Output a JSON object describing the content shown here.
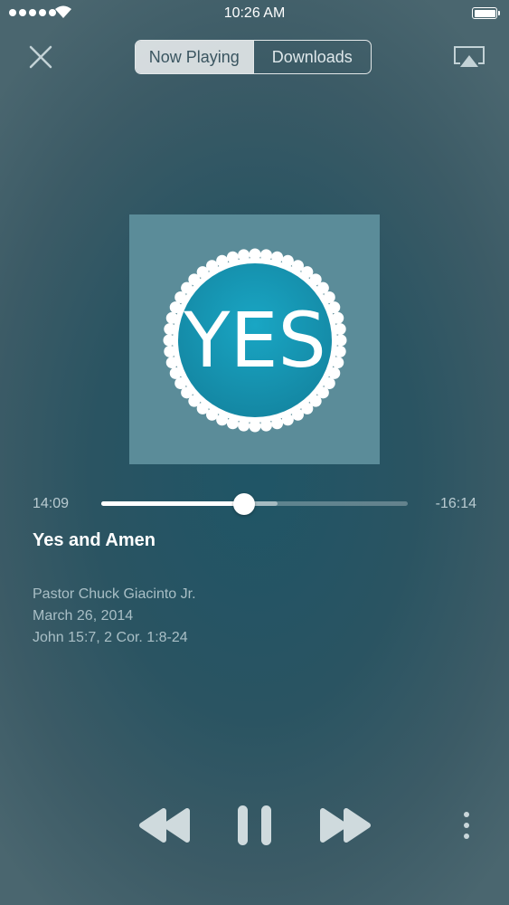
{
  "status_bar": {
    "time": "10:26 AM",
    "signal_bars": 5,
    "battery_level": 1.0
  },
  "nav": {
    "close_icon": "close-icon",
    "tabs": [
      {
        "label": "Now Playing",
        "active": true
      },
      {
        "label": "Downloads",
        "active": false
      }
    ],
    "airplay_icon": "airplay-icon"
  },
  "artwork": {
    "text": "YES",
    "background_color": "#5b8c99",
    "badge_color": "#1a9bb8"
  },
  "player": {
    "elapsed": "14:09",
    "remaining": "-16:14",
    "progress": 0.465,
    "buffered": 0.575
  },
  "track": {
    "title": "Yes and Amen",
    "speaker": "Pastor Chuck Giacinto Jr.",
    "date": "March 26, 2014",
    "scripture": "John 15:7, 2 Cor. 1:8-24"
  },
  "controls": {
    "rewind_icon": "rewind-icon",
    "pause_icon": "pause-icon",
    "forward_icon": "fast-forward-icon",
    "more_icon": "more-vertical-icon"
  }
}
